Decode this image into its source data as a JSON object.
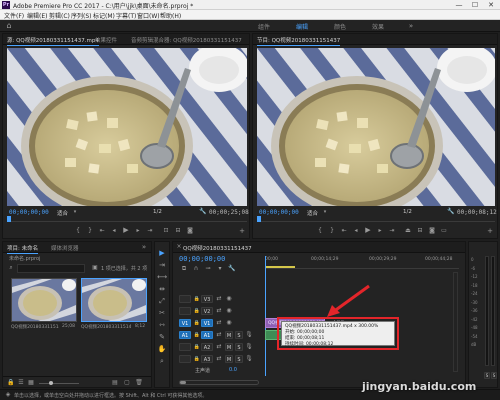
{
  "window": {
    "title": "Adobe Premiere Pro CC 2017 - C:\\用户\\jjk\\桌面\\未命名.prproj *",
    "logo": "Pr",
    "controls": [
      "—",
      "☐",
      "✕"
    ]
  },
  "menu": [
    "文件(F)",
    "编辑(E)",
    "剪辑(C)",
    "序列(S)",
    "标记(M)",
    "字幕(T)",
    "窗口(W)",
    "帮助(H)"
  ],
  "workspaces": [
    {
      "label": "组件",
      "active": false
    },
    {
      "label": "编辑",
      "active": true
    },
    {
      "label": "颜色",
      "active": false
    },
    {
      "label": "效果",
      "active": false
    }
  ],
  "source_panel": {
    "tabs": [
      {
        "label": "源: QQ视频20180331151437.mp4",
        "active": true
      },
      {
        "label": "效果控件",
        "active": false
      },
      {
        "label": "音频剪辑混合器: QQ视频20180331151437",
        "active": false
      }
    ],
    "timecode_in": "00;00;00;00",
    "fit": "适合",
    "page": "1/2",
    "timecode_out": "00;00;25;08"
  },
  "program_panel": {
    "tab": "节目: QQ视频20180331151437",
    "timecode_in": "00;00;00;00",
    "fit": "适合",
    "page": "1/2",
    "timecode_out": "00;00;08;12"
  },
  "project_panel": {
    "tabs": [
      {
        "label": "项目: 未命名",
        "active": true
      },
      {
        "label": "媒体浏览器",
        "active": false
      }
    ],
    "file": "未命名.prproj",
    "search_placeholder": "",
    "status": "1 项已选择，共 2 项",
    "items": [
      {
        "name": "QQ视频20180331151437...",
        "duration": "25;08"
      },
      {
        "name": "QQ视频20180331151437",
        "duration": "8;12"
      }
    ]
  },
  "timeline": {
    "tab": "QQ视频20180331151437",
    "timecode": "00;00;00;00",
    "ruler": [
      "00;00",
      "00;00;14;29",
      "00;00;29;29",
      "00;00;44;28"
    ],
    "video_tracks": [
      {
        "src": "",
        "name": "V3"
      },
      {
        "src": "",
        "name": "V2"
      },
      {
        "src": "V1",
        "name": "V1"
      }
    ],
    "audio_tracks": [
      {
        "src": "A1",
        "name": "A1"
      },
      {
        "src": "",
        "name": "A2"
      },
      {
        "src": "",
        "name": "A3"
      }
    ],
    "master_label": "主声道",
    "master_value": "0.0",
    "clip_label": "QQ视频20180331151437.mp4 [V]",
    "tooltip": {
      "line1": "QQ视频20180331151437.mp4 x 300.00%",
      "line2": "开始: 00;00;00;00",
      "line3": "结束: 00;00;08;11",
      "line4": "持续时间: 00;00;08;12"
    }
  },
  "audio_meter": {
    "scale": [
      "0",
      "-6",
      "-12",
      "-18",
      "-24",
      "-30",
      "-36",
      "-42",
      "-48",
      "-54",
      "dB"
    ],
    "channels": [
      "S",
      "S"
    ]
  },
  "statusbar": "单击以选择，或单击空白处并拖动以进行框选。按 Shift、Alt 和 Ctrl 可获得其他选项。",
  "watermark": "jingyan.baidu.com",
  "colors": {
    "accent": "#4aa3ff",
    "annotation": "#e3252a",
    "panel": "#232323"
  }
}
